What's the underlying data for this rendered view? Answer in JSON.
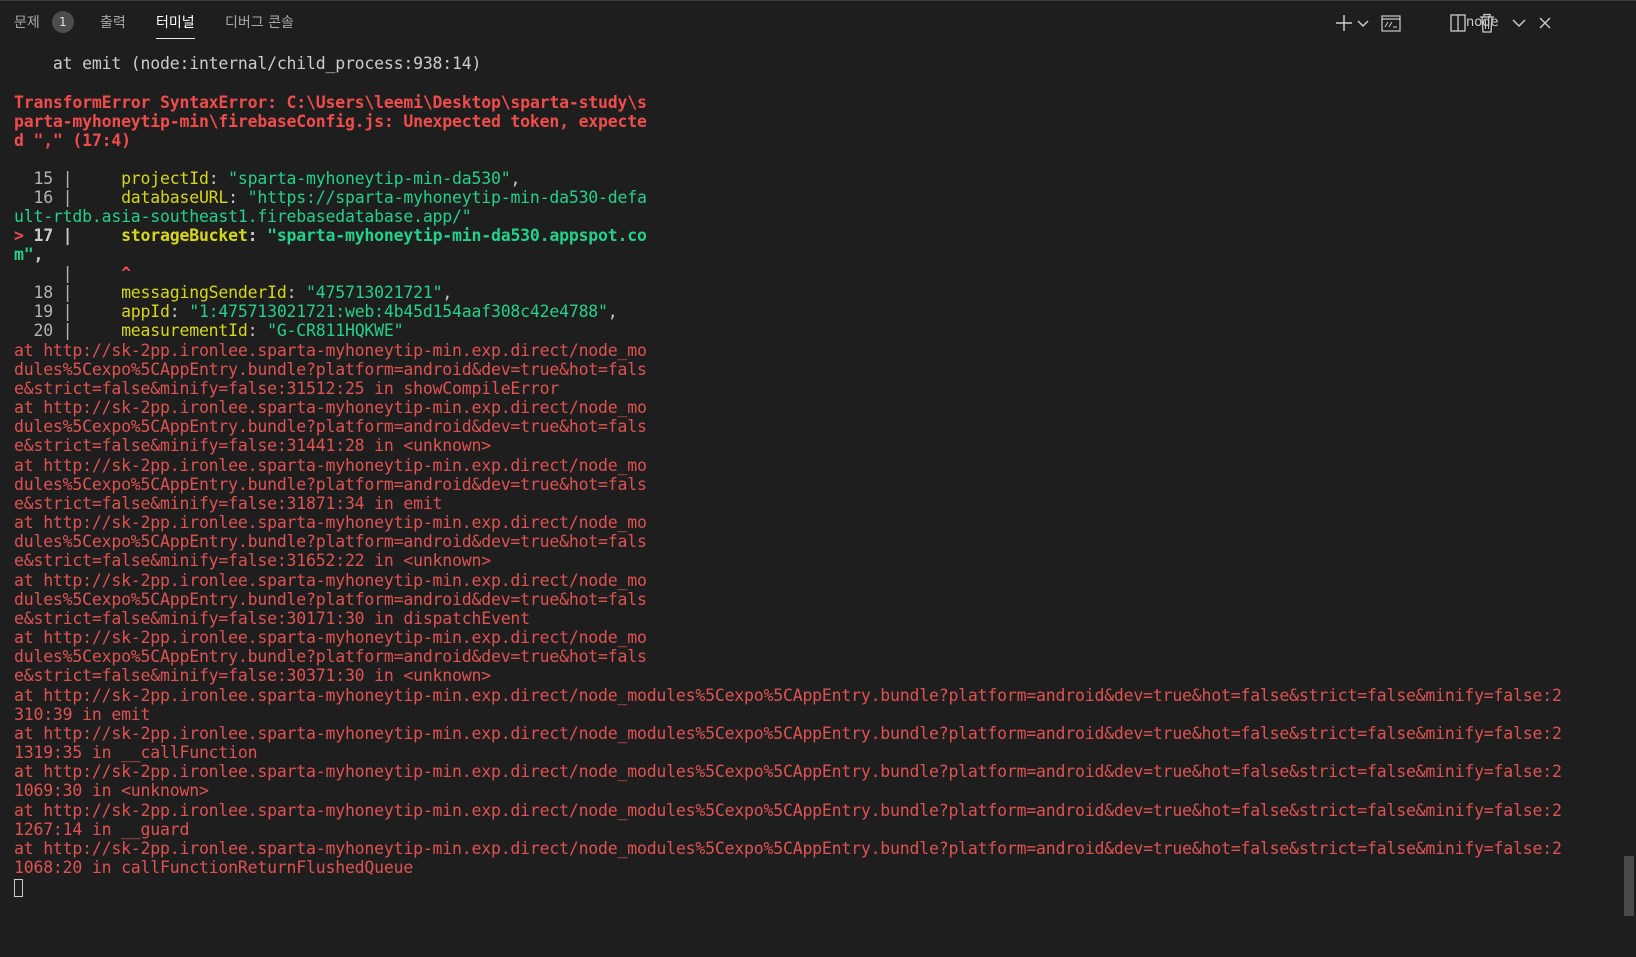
{
  "tabs": {
    "problems": "문제",
    "problems_count": "1",
    "output": "출력",
    "terminal": "터미널",
    "debug_console": "디버그 콘솔"
  },
  "toolbar": {
    "shell_name": "node",
    "icons": [
      "add-icon",
      "chevron-down-icon",
      "terminal-icon",
      "split-icon",
      "trash-icon",
      "chevron-down-icon",
      "close-icon"
    ]
  },
  "terminal": {
    "line01": "    at emit (node:internal/child_process:938:14)",
    "line02": "TransformError SyntaxError: C:\\Users\\leemi\\Desktop\\sparta-study\\s",
    "line03": "parta-myhoneytip-min\\firebaseConfig.js: Unexpected token, expecte",
    "line04": "d \",\" (17:4)",
    "line05_num": "  15 |     ",
    "line05_key": "projectId",
    "line05_colon": ": ",
    "line05_val": "\"sparta-myhoneytip-min-da530\"",
    "line05_end": ",",
    "line06_num": "  16 |     ",
    "line06_key": "databaseURL",
    "line06_colon": ": ",
    "line06_val": "\"https://sparta-myhoneytip-min-da530-defa",
    "line07_val": "ult-rtdb.asia-southeast1.firebasedatabase.app/\"",
    "line08_arrow": "> ",
    "line08_num": "17 |     ",
    "line08_key": "storageBucket",
    "line08_colon": ": ",
    "line08_val": "\"sparta-myhoneytip-min-da530.appspot.co",
    "line09_val": "m\"",
    "line09_end": ",",
    "line10_bar": "     |     ",
    "line10_caret": "^",
    "line11_num": "  18 |     ",
    "line11_key": "messagingSenderId",
    "line11_colon": ": ",
    "line11_val": "\"475713021721\"",
    "line11_end": ",",
    "line12_num": "  19 |     ",
    "line12_key": "appId",
    "line12_colon": ": ",
    "line12_val": "\"1:475713021721:web:4b45d154aaf308c42e4788\"",
    "line12_end": ",",
    "line13_num": "  20 |     ",
    "line13_key": "measurementId",
    "line13_colon": ": ",
    "line13_val": "\"G-CR811HQKWE\"",
    "line14": "at http://sk-2pp.ironlee.sparta-myhoneytip-min.exp.direct/node_mo",
    "line15": "dules%5Cexpo%5CAppEntry.bundle?platform=android&dev=true&hot=fals",
    "line16": "e&strict=false&minify=false:31512:25 in showCompileError",
    "line17": "at http://sk-2pp.ironlee.sparta-myhoneytip-min.exp.direct/node_mo",
    "line18": "dules%5Cexpo%5CAppEntry.bundle?platform=android&dev=true&hot=fals",
    "line19": "e&strict=false&minify=false:31441:28 in <unknown>",
    "line20": "at http://sk-2pp.ironlee.sparta-myhoneytip-min.exp.direct/node_mo",
    "line21": "dules%5Cexpo%5CAppEntry.bundle?platform=android&dev=true&hot=fals",
    "line22": "e&strict=false&minify=false:31871:34 in emit",
    "line23": "at http://sk-2pp.ironlee.sparta-myhoneytip-min.exp.direct/node_mo",
    "line24": "dules%5Cexpo%5CAppEntry.bundle?platform=android&dev=true&hot=fals",
    "line25": "e&strict=false&minify=false:31652:22 in <unknown>",
    "line26": "at http://sk-2pp.ironlee.sparta-myhoneytip-min.exp.direct/node_mo",
    "line27": "dules%5Cexpo%5CAppEntry.bundle?platform=android&dev=true&hot=fals",
    "line28": "e&strict=false&minify=false:30171:30 in dispatchEvent",
    "line29": "at http://sk-2pp.ironlee.sparta-myhoneytip-min.exp.direct/node_mo",
    "line30": "dules%5Cexpo%5CAppEntry.bundle?platform=android&dev=true&hot=fals",
    "line31": "e&strict=false&minify=false:30371:30 in <unknown>",
    "line32": "at http://sk-2pp.ironlee.sparta-myhoneytip-min.exp.direct/node_modules%5Cexpo%5CAppEntry.bundle?platform=android&dev=true&hot=false&strict=false&minify=false:2",
    "line33": "310:39 in emit",
    "line34": "at http://sk-2pp.ironlee.sparta-myhoneytip-min.exp.direct/node_modules%5Cexpo%5CAppEntry.bundle?platform=android&dev=true&hot=false&strict=false&minify=false:2",
    "line35": "1319:35 in __callFunction",
    "line36": "at http://sk-2pp.ironlee.sparta-myhoneytip-min.exp.direct/node_modules%5Cexpo%5CAppEntry.bundle?platform=android&dev=true&hot=false&strict=false&minify=false:2",
    "line37": "1069:30 in <unknown>",
    "line38": "at http://sk-2pp.ironlee.sparta-myhoneytip-min.exp.direct/node_modules%5Cexpo%5CAppEntry.bundle?platform=android&dev=true&hot=false&strict=false&minify=false:2",
    "line39": "1267:14 in __guard",
    "line40": "at http://sk-2pp.ironlee.sparta-myhoneytip-min.exp.direct/node_modules%5Cexpo%5CAppEntry.bundle?platform=android&dev=true&hot=false&strict=false&minify=false:2",
    "line41": "1068:20 in callFunctionReturnFlushedQueue"
  },
  "colors": {
    "background": "#1e1e1e",
    "error_red": "#f14c4c",
    "string_green": "#23d18b",
    "key_yellow": "#d6d61b"
  }
}
